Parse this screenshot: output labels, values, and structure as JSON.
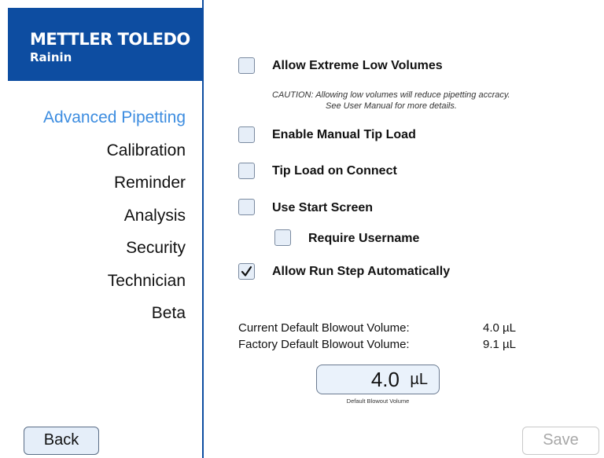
{
  "brand": {
    "name": "METTLER TOLEDO",
    "sub": "Rainin"
  },
  "nav": {
    "items": [
      {
        "label": "Advanced Pipetting",
        "active": true
      },
      {
        "label": "Calibration"
      },
      {
        "label": "Reminder"
      },
      {
        "label": "Analysis"
      },
      {
        "label": "Security"
      },
      {
        "label": "Technician"
      },
      {
        "label": "Beta"
      }
    ]
  },
  "options": {
    "extreme_low": {
      "label": "Allow Extreme Low Volumes",
      "checked": false
    },
    "caution_line1": "CAUTION:  Allowing low volumes will reduce pipetting accracy.",
    "caution_line2": "See User Manual for more details.",
    "manual_tip": {
      "label": "Enable Manual Tip Load",
      "checked": false
    },
    "tip_connect": {
      "label": "Tip Load on Connect",
      "checked": false
    },
    "start_screen": {
      "label": "Use Start Screen",
      "checked": false
    },
    "require_username": {
      "label": "Require Username",
      "checked": false
    },
    "run_step": {
      "label": "Allow Run Step Automatically",
      "checked": true
    }
  },
  "blowout": {
    "current_label": "Current Default Blowout Volume:",
    "current_value": "4.0 µL",
    "factory_label": "Factory Default Blowout Volume:",
    "factory_value": "9.1 µL",
    "field_value": "4.0",
    "field_unit": "µL",
    "field_caption": "Default Blowout Volume"
  },
  "buttons": {
    "back": "Back",
    "save": "Save"
  },
  "colors": {
    "brand_blue": "#0d4da1",
    "active_nav": "#3d8de0",
    "checkbox_fill": "#e6eef8"
  }
}
